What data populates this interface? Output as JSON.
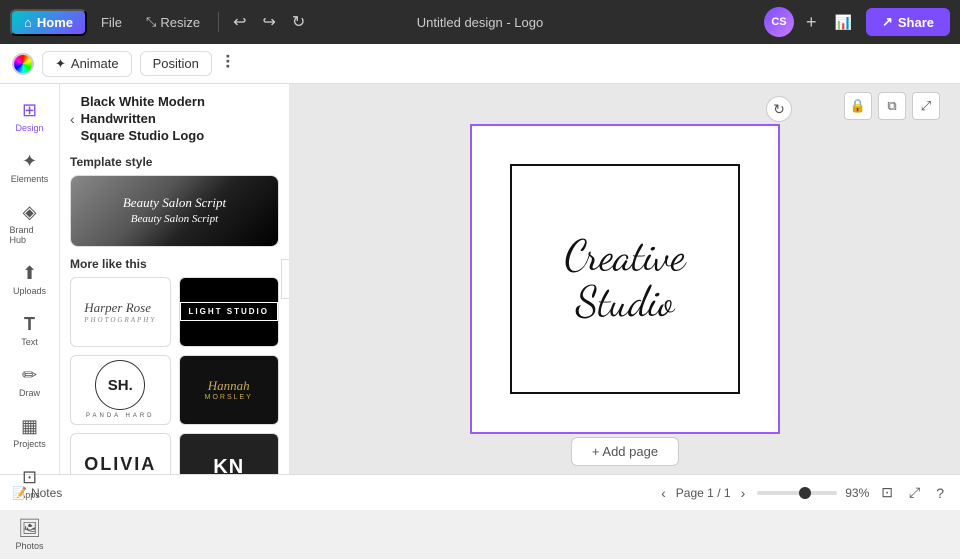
{
  "topbar": {
    "home_label": "Home",
    "file_label": "File",
    "resize_label": "Resize",
    "title": "Untitled design - Logo",
    "avatar_initials": "CS",
    "share_label": "Share"
  },
  "toolbar": {
    "animate_label": "Animate",
    "position_label": "Position"
  },
  "left_panel": {
    "back_arrow": "‹",
    "title_line1": "Black White Modern Handwritten",
    "title_line2": "Square Studio Logo",
    "template_style_label": "Template style",
    "template_style_text1": "Beauty Salon Script",
    "template_style_text2": "Beauty Salon Script",
    "more_like_this_label": "More like this",
    "thumbs": [
      {
        "id": "harper-rose",
        "type": "harper"
      },
      {
        "id": "light-studio",
        "type": "light",
        "text": "LIGHT  STUDIO"
      },
      {
        "id": "sh",
        "type": "sh",
        "text": "SH."
      },
      {
        "id": "hannah",
        "type": "hannah",
        "text": "Hannah"
      },
      {
        "id": "olivia",
        "type": "olivia",
        "text": "OLIVIA"
      },
      {
        "id": "kn",
        "type": "kn",
        "text": "KN"
      }
    ]
  },
  "sidebar_icons": [
    {
      "id": "design",
      "icon": "⊞",
      "label": "Design",
      "active": true
    },
    {
      "id": "elements",
      "icon": "✦",
      "label": "Elements"
    },
    {
      "id": "brand-hub",
      "icon": "◈",
      "label": "Brand Hub"
    },
    {
      "id": "uploads",
      "icon": "⬆",
      "label": "Uploads"
    },
    {
      "id": "text",
      "icon": "T",
      "label": "Text"
    },
    {
      "id": "draw",
      "icon": "✏",
      "label": "Draw"
    },
    {
      "id": "projects",
      "icon": "▦",
      "label": "Projects"
    },
    {
      "id": "apps",
      "icon": "⊡",
      "label": "Apps"
    },
    {
      "id": "photos",
      "icon": "🖼",
      "label": "Photos"
    }
  ],
  "canvas": {
    "logo_text_line1": "Creative",
    "logo_text_line2": "Studio",
    "add_page_label": "+ Add page"
  },
  "bottombar": {
    "notes_label": "Notes",
    "page_label": "Page",
    "page_current": "1",
    "page_total": "1",
    "zoom_label": "93%"
  }
}
